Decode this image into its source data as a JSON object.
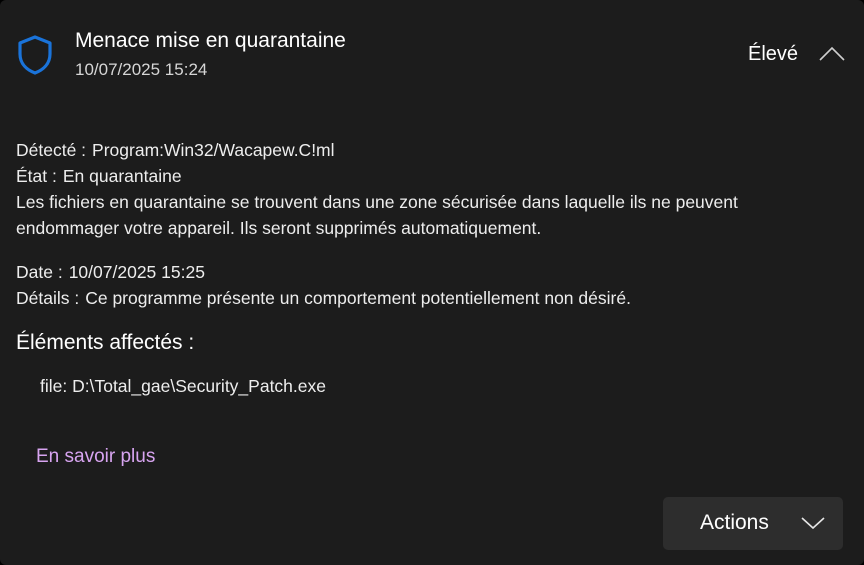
{
  "header": {
    "title": "Menace mise en quarantaine",
    "timestamp": "10/07/2025 15:24",
    "severity": "Élevé",
    "icon": "shield-icon",
    "collapse_icon": "chevron-up-icon"
  },
  "details": {
    "detected_label": "Détecté :",
    "detected_value": "Program:Win32/Wacapew.C!ml",
    "status_label": "État :",
    "status_value": "En quarantaine",
    "description_line1": "Les fichiers en quarantaine se trouvent dans une zone sécurisée dans laquelle ils ne peuvent",
    "description_line2": "endommager votre appareil. Ils seront supprimés automatiquement.",
    "date_label": "Date :",
    "date_value": "10/07/2025 15:25",
    "details_label": "Détails :",
    "details_value": "Ce programme présente un comportement potentiellement non désiré."
  },
  "affected": {
    "heading": "Éléments affectés :",
    "items": [
      "file: D:\\Total_gae\\Security_Patch.exe"
    ]
  },
  "learn_more": "En savoir plus",
  "actions": {
    "label": "Actions",
    "icon": "chevron-down-icon"
  },
  "colors": {
    "background": "#1c1c1c",
    "accent_shield": "#1a73d9",
    "link": "#d7a4f0",
    "button": "#2d2d2d"
  }
}
